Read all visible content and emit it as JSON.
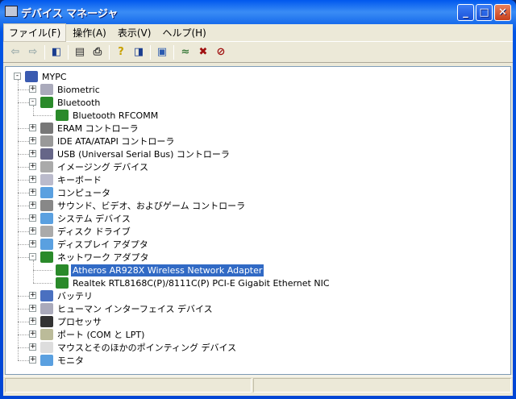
{
  "window": {
    "title": "デバイス マネージャ"
  },
  "menus": [
    {
      "label": "ファイル(F)"
    },
    {
      "label": "操作(A)"
    },
    {
      "label": "表示(V)"
    },
    {
      "label": "ヘルプ(H)"
    }
  ],
  "toolbar": [
    {
      "icon": "back-icon",
      "glyph": "⇦",
      "color": "#9aa"
    },
    {
      "icon": "forward-icon",
      "glyph": "⇨",
      "color": "#9aa"
    },
    {
      "sep": true
    },
    {
      "icon": "show-hide-console-tree-icon",
      "glyph": "◧",
      "color": "#1a3d8f"
    },
    {
      "sep": true
    },
    {
      "icon": "properties-icon",
      "glyph": "▤",
      "color": "#333"
    },
    {
      "icon": "print-icon",
      "glyph": "⎙",
      "color": "#333"
    },
    {
      "sep": true
    },
    {
      "icon": "help-icon",
      "glyph": "?",
      "color": "#c8a000"
    },
    {
      "icon": "show-hide-action-pane-icon",
      "glyph": "◨",
      "color": "#1a3d8f"
    },
    {
      "sep": true
    },
    {
      "icon": "scan-hardware-icon",
      "glyph": "▣",
      "color": "#2a5ab0"
    },
    {
      "sep": true
    },
    {
      "icon": "update-driver-icon",
      "glyph": "≈",
      "color": "#3a7a3a"
    },
    {
      "icon": "uninstall-icon",
      "glyph": "✖",
      "color": "#a01010"
    },
    {
      "icon": "disable-icon",
      "glyph": "⊘",
      "color": "#a01010"
    }
  ],
  "tree": [
    {
      "label": "MYPC",
      "level": 0,
      "exp": "-",
      "color": "#3a5ab0"
    },
    {
      "label": "Biometric",
      "level": 1,
      "exp": "+",
      "color": "#aab"
    },
    {
      "label": "Bluetooth",
      "level": 1,
      "exp": "-",
      "color": "#2a8a2a"
    },
    {
      "label": "Bluetooth RFCOMM",
      "level": 2,
      "color": "#2a8a2a"
    },
    {
      "label": "ERAM コントローラ",
      "level": 1,
      "exp": "+",
      "color": "#777"
    },
    {
      "label": "IDE ATA/ATAPI コントローラ",
      "level": 1,
      "exp": "+",
      "color": "#999"
    },
    {
      "label": "USB (Universal Serial Bus) コントローラ",
      "level": 1,
      "exp": "+",
      "color": "#668"
    },
    {
      "label": "イメージング デバイス",
      "level": 1,
      "exp": "+",
      "color": "#aaa"
    },
    {
      "label": "キーボード",
      "level": 1,
      "exp": "+",
      "color": "#bbc"
    },
    {
      "label": "コンピュータ",
      "level": 1,
      "exp": "+",
      "color": "#5aa0e0"
    },
    {
      "label": "サウンド、ビデオ、およびゲーム コントローラ",
      "level": 1,
      "exp": "+",
      "color": "#888"
    },
    {
      "label": "システム デバイス",
      "level": 1,
      "exp": "+",
      "color": "#5aa0e0"
    },
    {
      "label": "ディスク ドライブ",
      "level": 1,
      "exp": "+",
      "color": "#aaa"
    },
    {
      "label": "ディスプレイ アダプタ",
      "level": 1,
      "exp": "+",
      "color": "#5aa0e0"
    },
    {
      "label": "ネットワーク アダプタ",
      "level": 1,
      "exp": "-",
      "color": "#2a8a2a"
    },
    {
      "label": "Atheros AR928X Wireless Network Adapter",
      "level": 2,
      "color": "#2a8a2a",
      "selected": true
    },
    {
      "label": "Realtek RTL8168C(P)/8111C(P) PCI-E Gigabit Ethernet NIC",
      "level": 2,
      "color": "#2a8a2a"
    },
    {
      "label": "バッテリ",
      "level": 1,
      "exp": "+",
      "color": "#4a70c0"
    },
    {
      "label": "ヒューマン インターフェイス デバイス",
      "level": 1,
      "exp": "+",
      "color": "#aab"
    },
    {
      "label": "プロセッサ",
      "level": 1,
      "exp": "+",
      "color": "#333"
    },
    {
      "label": "ポート (COM と LPT)",
      "level": 1,
      "exp": "+",
      "color": "#bb9"
    },
    {
      "label": "マウスとそのほかのポインティング デバイス",
      "level": 1,
      "exp": "+",
      "color": "#ddd"
    },
    {
      "label": "モニタ",
      "level": 1,
      "exp": "+",
      "color": "#5aa0e0"
    }
  ]
}
